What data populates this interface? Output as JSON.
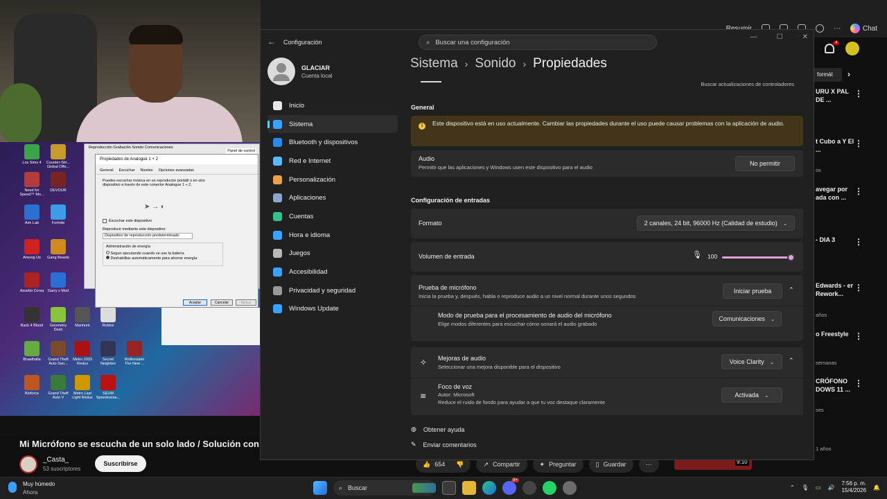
{
  "browser": {
    "summarize_label": "Resumir",
    "chat_label": "Chat"
  },
  "video": {
    "title": "Mi Micrófono se escucha de un solo lado / Solución con in",
    "channel": "_Casta_",
    "subscribers": "53 suscriptores",
    "subscribe_label": "Suscribirse",
    "likes": "654",
    "share_label": "Compartir",
    "ask_label": "Preguntar",
    "save_label": "Guardar",
    "next_duration": "9:10"
  },
  "desktop_icons": [
    {
      "label": "Los Sims 4",
      "color": "#3ba34a"
    },
    {
      "label": "Counter-Stri... Global Offe...",
      "color": "#c79a2c"
    },
    {
      "label": "Need for Speed™ Mo...",
      "color": "#b33b3b"
    },
    {
      "label": "DEVOUR",
      "color": "#7a2323"
    },
    {
      "label": "Aim Lab",
      "color": "#2d6fd1"
    },
    {
      "label": "Fortnite",
      "color": "#3d9be9"
    },
    {
      "label": "Among Us",
      "color": "#c22"
    },
    {
      "label": "Gang Beasts",
      "color": "#d18a1f"
    },
    {
      "label": "Assetto Corsa",
      "color": "#a22"
    },
    {
      "label": "Garry s Mod",
      "color": "#2a6fd6"
    },
    {
      "label": "Back 4 Blood",
      "color": "#333"
    },
    {
      "label": "Geometry Dash",
      "color": "#8ac43a"
    },
    {
      "label": "Manhunt",
      "color": "#555"
    },
    {
      "label": "Roblox",
      "color": "#ddd"
    },
    {
      "label": "Brawlhalla",
      "color": "#6a4"
    },
    {
      "label": "Grand Theft Auto San...",
      "color": "#7a4a2a"
    },
    {
      "label": "Metro 2033 Redux",
      "color": "#a11"
    },
    {
      "label": "Secret Neighbor",
      "color": "#335"
    },
    {
      "label": "Wolfenstein The New ...",
      "color": "#922"
    },
    {
      "label": "Bioforce",
      "color": "#b52"
    },
    {
      "label": "Grand Theft Auto V",
      "color": "#3a7a3a"
    },
    {
      "label": "Metro Last Light Redux",
      "color": "#c90"
    },
    {
      "label": "SEUM Speedrunne...",
      "color": "#b11"
    }
  ],
  "old_dialog": {
    "title": "Propiedades de Analogue 1 + 2",
    "back_tabs": "Reproducción   Grabación   Sonido   Comunicaciones",
    "back_panel": "Panel de control",
    "tabs": [
      "General",
      "Escuchar",
      "Niveles",
      "Opciones avanzadas"
    ],
    "description": "Puedes escuchar música en un reproductor portátil o en otro dispositivo a través de este conector Analogue 1 + 2.",
    "listen_checkbox": "Escuchar este dispositivo",
    "playback_label": "Reproducir mediante este dispositivo:",
    "playback_value": "Dispositivo de reproducción predeterminado",
    "power_label": "Administración de energía",
    "power_opt1": "Seguir ejecutando cuando se use la batería",
    "power_opt2": "Deshabilitar automáticamente para ahorrar energía",
    "ok": "Aceptar",
    "cancel": "Cancelar",
    "apply": "Aplicar"
  },
  "settings": {
    "app_title": "Configuración",
    "search_placeholder": "Buscar una configuración",
    "profile": {
      "name": "GLACIAR",
      "type": "Cuenta local"
    },
    "nav": [
      {
        "label": "Inicio",
        "color": "#e8e8e8"
      },
      {
        "label": "Sistema",
        "color": "#3aa3ff"
      },
      {
        "label": "Bluetooth y dispositivos",
        "color": "#2b8ae8"
      },
      {
        "label": "Red e Internet",
        "color": "#5cb8ff"
      },
      {
        "label": "Personalización",
        "color": "#e8a34a"
      },
      {
        "label": "Aplicaciones",
        "color": "#8aa6c8"
      },
      {
        "label": "Cuentas",
        "color": "#37c08a"
      },
      {
        "label": "Hora e idioma",
        "color": "#3aa3ff"
      },
      {
        "label": "Juegos",
        "color": "#b8b8b8"
      },
      {
        "label": "Accesibilidad",
        "color": "#3aa3ff"
      },
      {
        "label": "Privacidad y seguridad",
        "color": "#9a9a9a"
      },
      {
        "label": "Windows Update",
        "color": "#3aa3ff"
      }
    ],
    "breadcrumb": [
      "Sistema",
      "Sonido",
      "Propiedades"
    ],
    "driver_link": "Buscar actualizaciones de controladores",
    "general_header": "General",
    "warning": "Este dispositivo está en uso actualmente. Cambiar las propiedades durante el uso puede causar problemas con la aplicación de audio.",
    "audio": {
      "title": "Audio",
      "desc": "Permitir que las aplicaciones y Windows usen este dispositivo para el audio",
      "button": "No permitir"
    },
    "input_header": "Configuración de entradas",
    "format": {
      "title": "Formato",
      "value": "2 canales, 24 bit, 96000 Hz (Calidad de estudio)"
    },
    "volume": {
      "title": "Volumen de entrada",
      "value": "100",
      "level": 1.0
    },
    "mic_test": {
      "title": "Prueba de micrófono",
      "desc": "Inicia la prueba y, después, habla o reproduce audio a un nivel normal durante unos segundos",
      "button": "Iniciar prueba"
    },
    "test_mode": {
      "title": "Modo de prueba para el procesamiento de audio del micrófono",
      "desc": "Elige modos diferentes para escuchar cómo sonará el audio grabado",
      "value": "Comunicaciones"
    },
    "enhancements": {
      "title": "Mejoras de audio",
      "desc": "Seleccionar una mejora disponible para el dispositivo",
      "value": "Voice Clarity"
    },
    "voice_focus": {
      "title": "Foco de voz",
      "author": "Autor: Microsoft",
      "desc": "Reduce el ruido de fondo para ayudar a que tu voz destaque claramente",
      "value": "Activada"
    },
    "help_link": "Obtener ayuda",
    "feedback_link": "Enviar comentarios"
  },
  "yt_sidebar": {
    "chip": "formát",
    "notif_count": "4",
    "items": [
      {
        "text": "URU X PAL DE ..."
      },
      {
        "text": "t Cubo a Y El ..."
      },
      {
        "text": "avegar por ada con ..."
      },
      {
        "text": "- DIA 3"
      },
      {
        "text": "Edwards - er Rework..."
      },
      {
        "text": "o Freestyle"
      },
      {
        "text": "CRÓFONO DOWS 11 ..."
      }
    ],
    "metas": [
      "os",
      "años",
      "semanas",
      "ses",
      "1 años"
    ]
  },
  "taskbar": {
    "weather_title": "Muy húmedo",
    "weather_sub": "Ahora",
    "search_label": "Buscar",
    "discord_badge": "9+",
    "time": "7:56 p. m.",
    "date": "15/4/2026"
  }
}
